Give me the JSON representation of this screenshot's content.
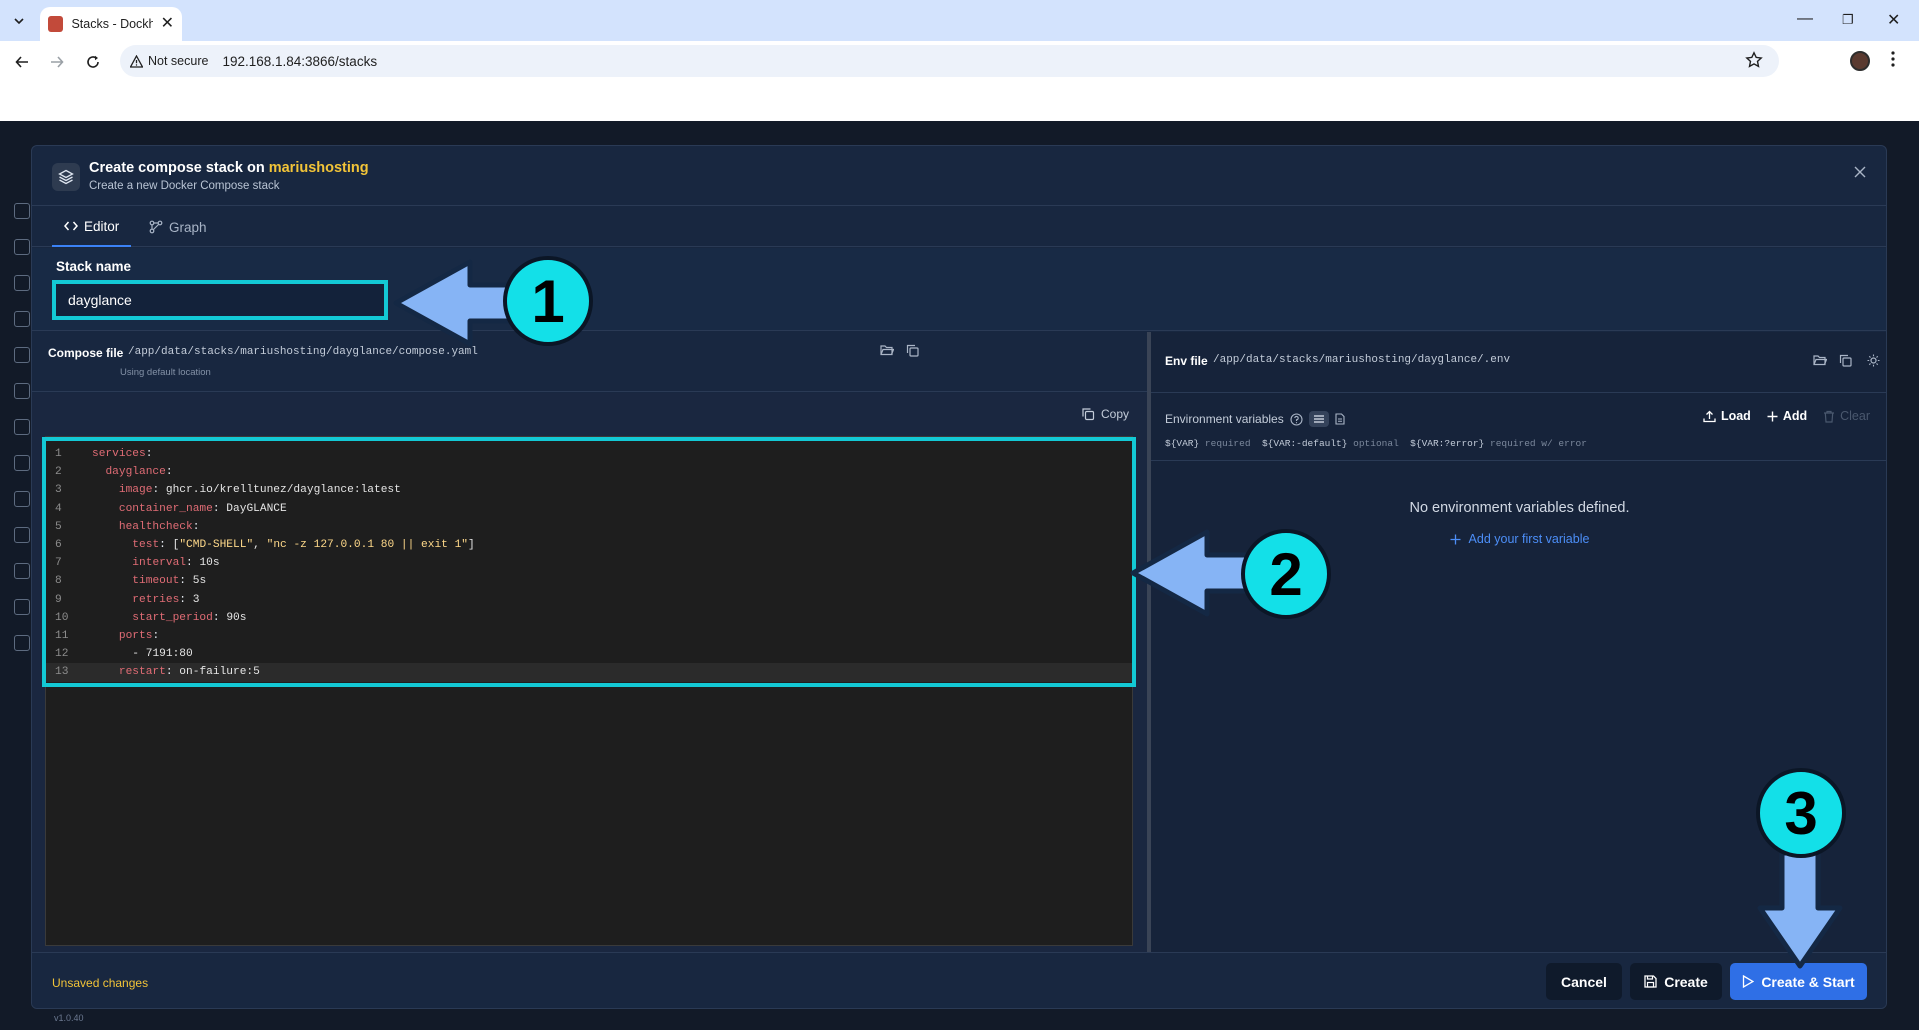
{
  "browser": {
    "tab_title": "Stacks - Dockh",
    "security_label": "Not secure",
    "url": "192.168.1.84:3866/stacks"
  },
  "app": {
    "version": "v1.0.40"
  },
  "modal": {
    "title_prefix": "Create compose stack on",
    "host": "mariushosting",
    "subtitle": "Create a new Docker Compose stack",
    "tabs": [
      {
        "label": "Editor",
        "active": true
      },
      {
        "label": "Graph",
        "active": false
      }
    ],
    "stack_name_label": "Stack name",
    "stack_name_value": "dayglance",
    "compose": {
      "label": "Compose file",
      "path": "/app/data/stacks/mariushosting/dayglance/compose.yaml",
      "hint": "Using default location",
      "copy_label": "Copy",
      "lines": [
        {
          "n": "1",
          "indent": "",
          "key": "services",
          "value": ""
        },
        {
          "n": "2",
          "indent": "  ",
          "key": "dayglance",
          "value": ""
        },
        {
          "n": "3",
          "indent": "    ",
          "key": "image",
          "value": "ghcr.io/krelltunez/dayglance:latest"
        },
        {
          "n": "4",
          "indent": "    ",
          "key": "container_name",
          "value": "DayGLANCE"
        },
        {
          "n": "5",
          "indent": "    ",
          "key": "healthcheck",
          "value": ""
        },
        {
          "n": "6",
          "indent": "      ",
          "key": "test",
          "value": "[\"CMD-SHELL\", \"nc -z 127.0.0.1 80 || exit 1\"]"
        },
        {
          "n": "7",
          "indent": "      ",
          "key": "interval",
          "value": "10s"
        },
        {
          "n": "8",
          "indent": "      ",
          "key": "timeout",
          "value": "5s"
        },
        {
          "n": "9",
          "indent": "      ",
          "key": "retries",
          "value": "3"
        },
        {
          "n": "10",
          "indent": "      ",
          "key": "start_period",
          "value": "90s"
        },
        {
          "n": "11",
          "indent": "    ",
          "key": "ports",
          "value": ""
        },
        {
          "n": "12",
          "indent": "      ",
          "key": "",
          "value": "- 7191:80"
        },
        {
          "n": "13",
          "indent": "    ",
          "key": "restart",
          "value": "on-failure:5"
        }
      ]
    },
    "env": {
      "label": "Env file",
      "path": "/app/data/stacks/mariushosting/dayglance/.env",
      "vars_label": "Environment variables",
      "load_label": "Load",
      "add_label": "Add",
      "clear_label": "Clear",
      "syntax_required": "${VAR}",
      "syntax_required_note": "required",
      "syntax_optional": "${VAR:-default}",
      "syntax_optional_note": "optional",
      "syntax_error": "${VAR:?error}",
      "syntax_error_note": "required w/ error",
      "empty_message": "No environment variables defined.",
      "add_first_label": "Add your first variable"
    },
    "footer": {
      "unsaved": "Unsaved changes",
      "cancel": "Cancel",
      "create": "Create",
      "create_start": "Create & Start"
    }
  },
  "annotations": {
    "step1": "1",
    "step2": "2",
    "step3": "3",
    "color_badge": "#13e0e8",
    "color_arrow": "#86b4f5"
  },
  "colors": {
    "accent": "#2f6fe6",
    "highlight": "#13c9d5",
    "host": "#f2c438"
  }
}
